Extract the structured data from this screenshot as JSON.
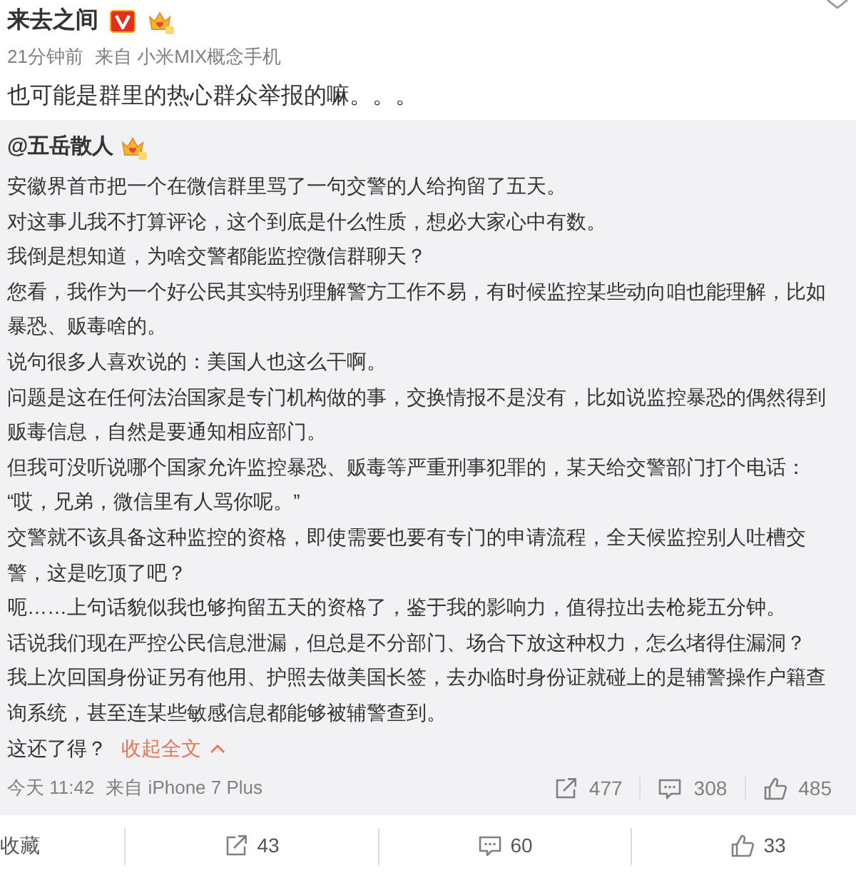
{
  "post": {
    "author": "来去之间",
    "time": "21分钟前",
    "source": "来自 小米MIX概念手机",
    "text": "也可能是群里的热心群众举报的嘛。。。"
  },
  "repost": {
    "author": "@五岳散人",
    "paragraphs": [
      "安徽界首市把一个在微信群里骂了一句交警的人给拘留了五天。",
      "对这事儿我不打算评论，这个到底是什么性质，想必大家心中有数。",
      "我倒是想知道，为啥交警都能监控微信群聊天？",
      "您看，我作为一个好公民其实特别理解警方工作不易，有时候监控某些动向咱也能理解，比如暴恐、贩毒啥的。",
      "说句很多人喜欢说的：美国人也这么干啊。",
      "问题是这在任何法治国家是专门机构做的事，交换情报不是没有，比如说监控暴恐的偶然得到贩毒信息，自然是要通知相应部门。",
      "但我可没听说哪个国家允许监控暴恐、贩毒等严重刑事犯罪的，某天给交警部门打个电话：“哎，兄弟，微信里有人骂你呢。”",
      "交警就不该具备这种监控的资格，即使需要也要有专门的申请流程，全天候监控别人吐槽交警，这是吃顶了吧？",
      "呃……上句话貌似我也够拘留五天的资格了，鉴于我的影响力，值得拉出去枪毙五分钟。",
      "话说我们现在严控公民信息泄漏，但总是不分部门、场合下放这种权力，怎么堵得住漏洞？",
      "我上次回国身份证另有他用、护照去做美国长签，去办临时身份证就碰上的是辅警操作户籍查询系统，甚至连某些敏感信息都能够被辅警查到。"
    ],
    "closing": {
      "text": "这还了得？",
      "link": "收起全文"
    },
    "time": "今天 11:42",
    "source": "来自 iPhone 7 Plus",
    "stats": [
      {
        "kind": "repost",
        "count": "477"
      },
      {
        "kind": "comment",
        "count": "308"
      },
      {
        "kind": "like",
        "count": "485"
      }
    ]
  },
  "action_bar": [
    {
      "kind": "favorite",
      "label": "收藏"
    },
    {
      "kind": "repost",
      "count": "43"
    },
    {
      "kind": "comment",
      "count": "60"
    },
    {
      "kind": "like",
      "count": "33"
    }
  ]
}
